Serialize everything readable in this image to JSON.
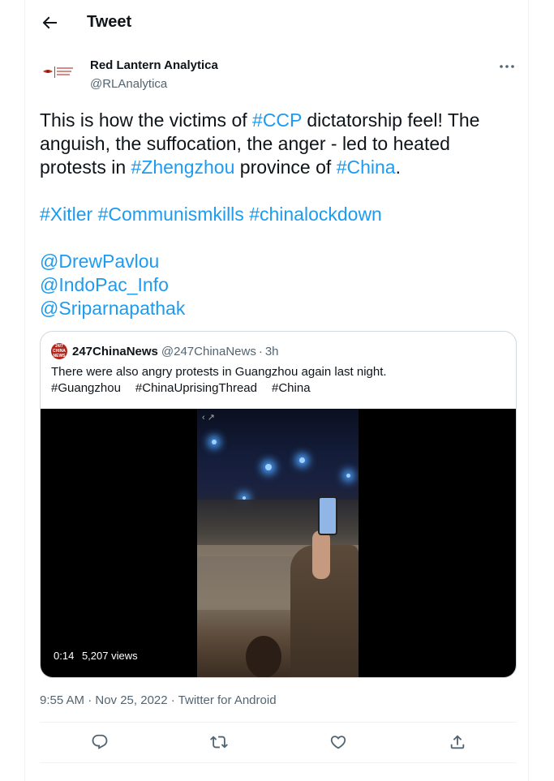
{
  "header": {
    "title": "Tweet"
  },
  "author": {
    "name": "Red Lantern Analytica",
    "handle": "@RLAnalytica",
    "avatar_text": "Red Lantern Analytica"
  },
  "tweet": {
    "line1_a": "This is how the victims of ",
    "line1_tag": "#CCP",
    "line1_b": " dictatorship feel! The anguish, the suffocation, the anger - led to heated protests in ",
    "line1_tag2": "#Zhengzhou",
    "line1_c": " province of ",
    "line1_tag3": "#China",
    "line1_d": ".",
    "hashtags": [
      "#Xitler",
      "#Communismkills",
      "#chinalockdown"
    ],
    "mentions": [
      "@DrewPavlou",
      "@IndoPac_Info",
      "@Sriparnapathak"
    ]
  },
  "quote": {
    "avatar_text": "24/7 CHINA NEWS",
    "name": "247ChinaNews",
    "handle": "@247ChinaNews",
    "dot": "·",
    "time": "3h",
    "text": "There were also angry protests in Guangzhou again last night.",
    "tags": [
      "#Guangzhou",
      "#ChinaUprisingThread",
      "#China"
    ],
    "video": {
      "duration": "0:14",
      "views": "5,207 views"
    }
  },
  "meta": {
    "text": "9:55 AM · Nov 25, 2022 · Twitter for Android"
  },
  "icons": {
    "back": "arrow-left-icon",
    "more": "more-horizontal-icon",
    "reply": "reply-icon",
    "retweet": "retweet-icon",
    "like": "heart-icon",
    "share": "share-icon"
  },
  "colors": {
    "link": "#1d9bf0",
    "secondary": "#536471"
  }
}
